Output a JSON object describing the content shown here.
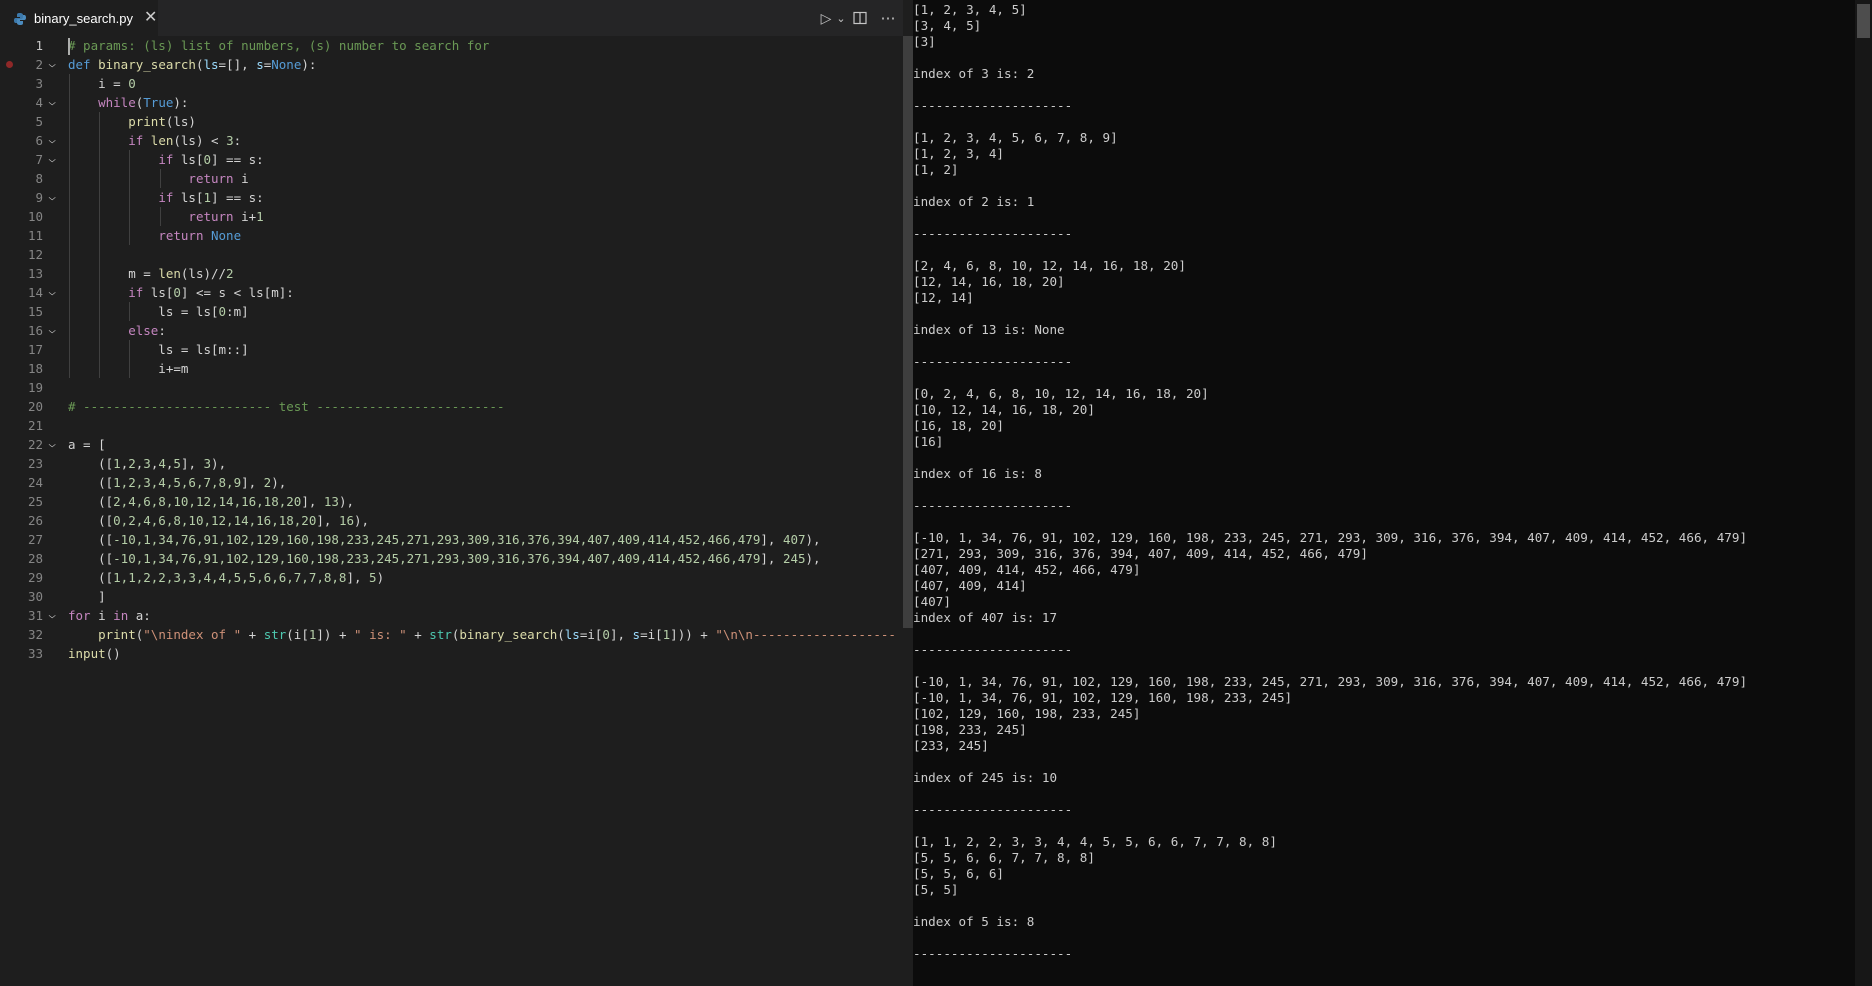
{
  "editor": {
    "tab": {
      "filename": "binary_search.py",
      "close_glyph": "✕"
    },
    "actions": {
      "run_glyph": "▷",
      "run_dropdown_glyph": "⌄",
      "more_glyph": "⋯"
    },
    "breakpoint_line": 2,
    "lines": [
      {
        "n": "1",
        "tokens": [
          {
            "t": "# params: (ls) list of numbers, (s) number to search for",
            "c": "cm"
          }
        ]
      },
      {
        "n": "2",
        "tokens": [
          {
            "t": "def ",
            "c": "kd"
          },
          {
            "t": "binary_search",
            "c": "fn"
          },
          {
            "t": "(",
            "c": "plain"
          },
          {
            "t": "ls",
            "c": "par"
          },
          {
            "t": "=[], ",
            "c": "plain"
          },
          {
            "t": "s",
            "c": "par"
          },
          {
            "t": "=",
            "c": "plain"
          },
          {
            "t": "None",
            "c": "kd"
          },
          {
            "t": "):",
            "c": "plain"
          }
        ]
      },
      {
        "n": "3",
        "tokens": [
          {
            "t": "    i = ",
            "c": "plain"
          },
          {
            "t": "0",
            "c": "num"
          }
        ]
      },
      {
        "n": "4",
        "tokens": [
          {
            "t": "    ",
            "c": "plain"
          },
          {
            "t": "while",
            "c": "kw"
          },
          {
            "t": "(",
            "c": "plain"
          },
          {
            "t": "True",
            "c": "kd"
          },
          {
            "t": "):",
            "c": "plain"
          }
        ]
      },
      {
        "n": "5",
        "tokens": [
          {
            "t": "        ",
            "c": "plain"
          },
          {
            "t": "print",
            "c": "fn"
          },
          {
            "t": "(ls)",
            "c": "plain"
          }
        ]
      },
      {
        "n": "6",
        "tokens": [
          {
            "t": "        ",
            "c": "plain"
          },
          {
            "t": "if ",
            "c": "kw"
          },
          {
            "t": "len",
            "c": "fn"
          },
          {
            "t": "(ls) < ",
            "c": "plain"
          },
          {
            "t": "3",
            "c": "num"
          },
          {
            "t": ":",
            "c": "plain"
          }
        ]
      },
      {
        "n": "7",
        "tokens": [
          {
            "t": "            ",
            "c": "plain"
          },
          {
            "t": "if ",
            "c": "kw"
          },
          {
            "t": "ls[",
            "c": "plain"
          },
          {
            "t": "0",
            "c": "num"
          },
          {
            "t": "] == s:",
            "c": "plain"
          }
        ]
      },
      {
        "n": "8",
        "tokens": [
          {
            "t": "                ",
            "c": "plain"
          },
          {
            "t": "return ",
            "c": "kw"
          },
          {
            "t": "i",
            "c": "plain"
          }
        ]
      },
      {
        "n": "9",
        "tokens": [
          {
            "t": "            ",
            "c": "plain"
          },
          {
            "t": "if ",
            "c": "kw"
          },
          {
            "t": "ls[",
            "c": "plain"
          },
          {
            "t": "1",
            "c": "num"
          },
          {
            "t": "] == s:",
            "c": "plain"
          }
        ]
      },
      {
        "n": "10",
        "tokens": [
          {
            "t": "                ",
            "c": "plain"
          },
          {
            "t": "return ",
            "c": "kw"
          },
          {
            "t": "i+",
            "c": "plain"
          },
          {
            "t": "1",
            "c": "num"
          }
        ]
      },
      {
        "n": "11",
        "tokens": [
          {
            "t": "            ",
            "c": "plain"
          },
          {
            "t": "return ",
            "c": "kw"
          },
          {
            "t": "None",
            "c": "kd"
          }
        ]
      },
      {
        "n": "12",
        "tokens": []
      },
      {
        "n": "13",
        "tokens": [
          {
            "t": "        m = ",
            "c": "plain"
          },
          {
            "t": "len",
            "c": "fn"
          },
          {
            "t": "(ls)//",
            "c": "plain"
          },
          {
            "t": "2",
            "c": "num"
          }
        ]
      },
      {
        "n": "14",
        "tokens": [
          {
            "t": "        ",
            "c": "plain"
          },
          {
            "t": "if ",
            "c": "kw"
          },
          {
            "t": "ls[",
            "c": "plain"
          },
          {
            "t": "0",
            "c": "num"
          },
          {
            "t": "] <= s < ls[m]:",
            "c": "plain"
          }
        ]
      },
      {
        "n": "15",
        "tokens": [
          {
            "t": "            ls = ls[",
            "c": "plain"
          },
          {
            "t": "0",
            "c": "num"
          },
          {
            "t": ":m]",
            "c": "plain"
          }
        ]
      },
      {
        "n": "16",
        "tokens": [
          {
            "t": "        ",
            "c": "plain"
          },
          {
            "t": "else",
            "c": "kw"
          },
          {
            "t": ":",
            "c": "plain"
          }
        ]
      },
      {
        "n": "17",
        "tokens": [
          {
            "t": "            ls = ls[m::]",
            "c": "plain"
          }
        ]
      },
      {
        "n": "18",
        "tokens": [
          {
            "t": "            i+=m",
            "c": "plain"
          }
        ]
      },
      {
        "n": "19",
        "tokens": []
      },
      {
        "n": "20",
        "tokens": [
          {
            "t": "# ------------------------- test -------------------------",
            "c": "cm"
          }
        ]
      },
      {
        "n": "21",
        "tokens": []
      },
      {
        "n": "22",
        "tokens": [
          {
            "t": "a = [",
            "c": "plain"
          }
        ]
      },
      {
        "n": "23",
        "tokens": [
          {
            "t": "    ([",
            "c": "plain"
          },
          {
            "t": "1",
            "c": "num"
          },
          {
            "t": ",",
            "c": "plain"
          },
          {
            "t": "2",
            "c": "num"
          },
          {
            "t": ",",
            "c": "plain"
          },
          {
            "t": "3",
            "c": "num"
          },
          {
            "t": ",",
            "c": "plain"
          },
          {
            "t": "4",
            "c": "num"
          },
          {
            "t": ",",
            "c": "plain"
          },
          {
            "t": "5",
            "c": "num"
          },
          {
            "t": "], ",
            "c": "plain"
          },
          {
            "t": "3",
            "c": "num"
          },
          {
            "t": "),",
            "c": "plain"
          }
        ]
      },
      {
        "n": "24",
        "tokens": [
          {
            "t": "    ([",
            "c": "plain"
          },
          {
            "t": "1,2,3,4,5,6,7,8,9",
            "c": "num"
          },
          {
            "t": "], ",
            "c": "plain"
          },
          {
            "t": "2",
            "c": "num"
          },
          {
            "t": "),",
            "c": "plain"
          }
        ]
      },
      {
        "n": "25",
        "tokens": [
          {
            "t": "    ([",
            "c": "plain"
          },
          {
            "t": "2,4,6,8,10,12,14,16,18,20",
            "c": "num"
          },
          {
            "t": "], ",
            "c": "plain"
          },
          {
            "t": "13",
            "c": "num"
          },
          {
            "t": "),",
            "c": "plain"
          }
        ]
      },
      {
        "n": "26",
        "tokens": [
          {
            "t": "    ([",
            "c": "plain"
          },
          {
            "t": "0,2,4,6,8,10,12,14,16,18,20",
            "c": "num"
          },
          {
            "t": "], ",
            "c": "plain"
          },
          {
            "t": "16",
            "c": "num"
          },
          {
            "t": "),",
            "c": "plain"
          }
        ]
      },
      {
        "n": "27",
        "tokens": [
          {
            "t": "    ([",
            "c": "plain"
          },
          {
            "t": "-10,1,34,76,91,102,129,160,198,233,245,271,293,309,316,376,394,407,409,414,452,466,479",
            "c": "num"
          },
          {
            "t": "], ",
            "c": "plain"
          },
          {
            "t": "407",
            "c": "num"
          },
          {
            "t": "),",
            "c": "plain"
          }
        ]
      },
      {
        "n": "28",
        "tokens": [
          {
            "t": "    ([",
            "c": "plain"
          },
          {
            "t": "-10,1,34,76,91,102,129,160,198,233,245,271,293,309,316,376,394,407,409,414,452,466,479",
            "c": "num"
          },
          {
            "t": "], ",
            "c": "plain"
          },
          {
            "t": "245",
            "c": "num"
          },
          {
            "t": "),",
            "c": "plain"
          }
        ]
      },
      {
        "n": "29",
        "tokens": [
          {
            "t": "    ([",
            "c": "plain"
          },
          {
            "t": "1,1,2,2,3,3,4,4,5,5,6,6,7,7,8,8",
            "c": "num"
          },
          {
            "t": "], ",
            "c": "plain"
          },
          {
            "t": "5",
            "c": "num"
          },
          {
            "t": ")",
            "c": "plain"
          }
        ]
      },
      {
        "n": "30",
        "tokens": [
          {
            "t": "    ]",
            "c": "plain"
          }
        ]
      },
      {
        "n": "31",
        "tokens": [
          {
            "t": "for ",
            "c": "kw"
          },
          {
            "t": "i ",
            "c": "plain"
          },
          {
            "t": "in ",
            "c": "kw"
          },
          {
            "t": "a:",
            "c": "plain"
          }
        ]
      },
      {
        "n": "32",
        "tokens": [
          {
            "t": "    ",
            "c": "plain"
          },
          {
            "t": "print",
            "c": "fn"
          },
          {
            "t": "(",
            "c": "plain"
          },
          {
            "t": "\"\\nindex of \"",
            "c": "str"
          },
          {
            "t": " + ",
            "c": "plain"
          },
          {
            "t": "str",
            "c": "bi"
          },
          {
            "t": "(i[",
            "c": "plain"
          },
          {
            "t": "1",
            "c": "num"
          },
          {
            "t": "]) + ",
            "c": "plain"
          },
          {
            "t": "\" is: \"",
            "c": "str"
          },
          {
            "t": " + ",
            "c": "plain"
          },
          {
            "t": "str",
            "c": "bi"
          },
          {
            "t": "(",
            "c": "plain"
          },
          {
            "t": "binary_search",
            "c": "fn"
          },
          {
            "t": "(",
            "c": "plain"
          },
          {
            "t": "ls",
            "c": "par"
          },
          {
            "t": "=i[",
            "c": "plain"
          },
          {
            "t": "0",
            "c": "num"
          },
          {
            "t": "], ",
            "c": "plain"
          },
          {
            "t": "s",
            "c": "par"
          },
          {
            "t": "=i[",
            "c": "plain"
          },
          {
            "t": "1",
            "c": "num"
          },
          {
            "t": "])) + ",
            "c": "plain"
          },
          {
            "t": "\"\\n\\n-------------------",
            "c": "str"
          }
        ]
      },
      {
        "n": "33",
        "tokens": [
          {
            "t": "input",
            "c": "fn"
          },
          {
            "t": "()",
            "c": "plain"
          }
        ]
      }
    ]
  },
  "console": {
    "lines": [
      "[1, 2, 3, 4, 5]",
      "[3, 4, 5]",
      "[3]",
      "",
      "index of 3 is: 2",
      "",
      "---------------------",
      "",
      "[1, 2, 3, 4, 5, 6, 7, 8, 9]",
      "[1, 2, 3, 4]",
      "[1, 2]",
      "",
      "index of 2 is: 1",
      "",
      "---------------------",
      "",
      "[2, 4, 6, 8, 10, 12, 14, 16, 18, 20]",
      "[12, 14, 16, 18, 20]",
      "[12, 14]",
      "",
      "index of 13 is: None",
      "",
      "---------------------",
      "",
      "[0, 2, 4, 6, 8, 10, 12, 14, 16, 18, 20]",
      "[10, 12, 14, 16, 18, 20]",
      "[16, 18, 20]",
      "[16]",
      "",
      "index of 16 is: 8",
      "",
      "---------------------",
      "",
      "[-10, 1, 34, 76, 91, 102, 129, 160, 198, 233, 245, 271, 293, 309, 316, 376, 394, 407, 409, 414, 452, 466, 479]",
      "[271, 293, 309, 316, 376, 394, 407, 409, 414, 452, 466, 479]",
      "[407, 409, 414, 452, 466, 479]",
      "[407, 409, 414]",
      "[407]",
      "index of 407 is: 17",
      "",
      "---------------------",
      "",
      "[-10, 1, 34, 76, 91, 102, 129, 160, 198, 233, 245, 271, 293, 309, 316, 376, 394, 407, 409, 414, 452, 466, 479]",
      "[-10, 1, 34, 76, 91, 102, 129, 160, 198, 233, 245]",
      "[102, 129, 160, 198, 233, 245]",
      "[198, 233, 245]",
      "[233, 245]",
      "",
      "index of 245 is: 10",
      "",
      "---------------------",
      "",
      "[1, 1, 2, 2, 3, 3, 4, 4, 5, 5, 6, 6, 7, 7, 8, 8]",
      "[5, 5, 6, 6, 7, 7, 8, 8]",
      "[5, 5, 6, 6]",
      "[5, 5]",
      "",
      "index of 5 is: 8",
      "",
      "---------------------"
    ]
  }
}
